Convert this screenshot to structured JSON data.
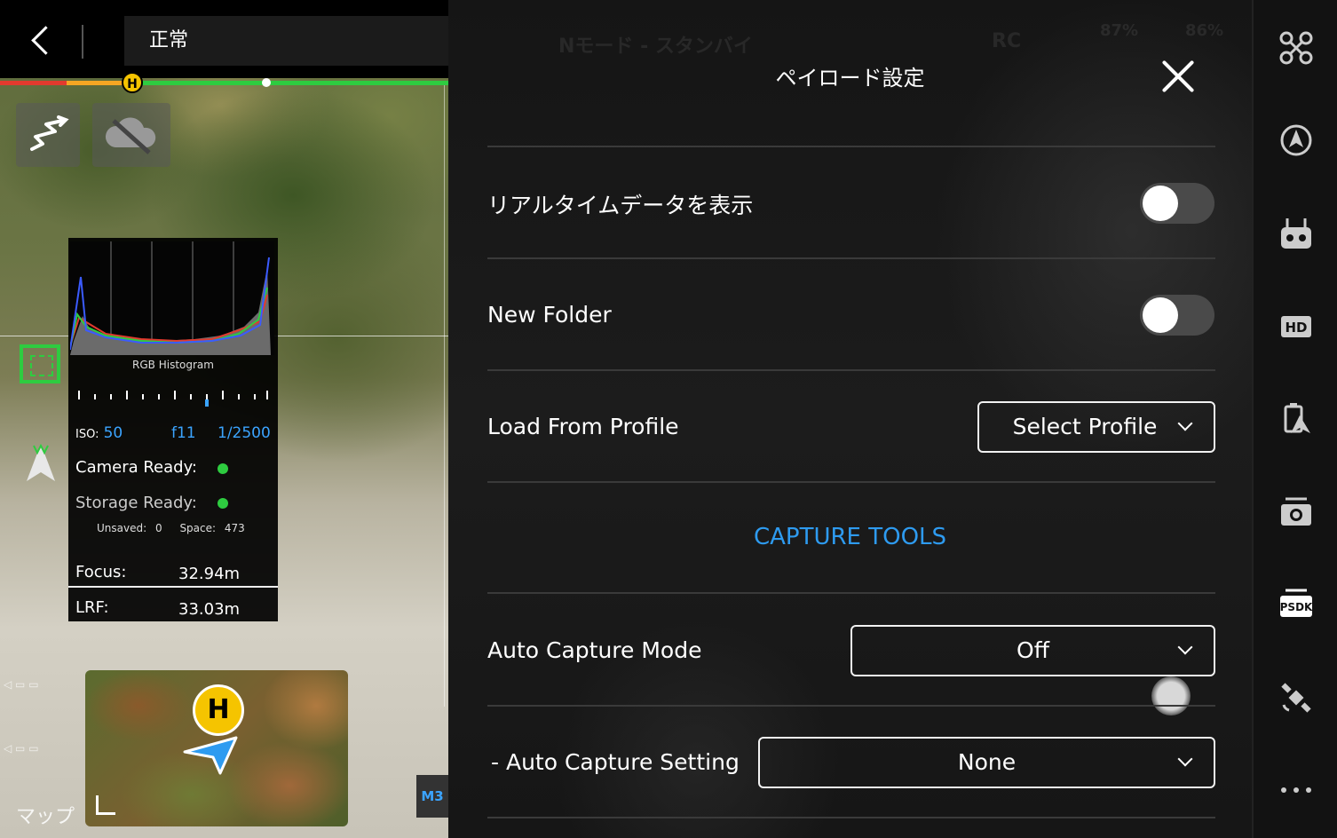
{
  "status": {
    "text": "正常"
  },
  "progress": {
    "home_marker": "H"
  },
  "histogram": {
    "label": "RGB Histogram",
    "iso_label": "ISO:",
    "iso_value": "50",
    "aperture": "f11",
    "shutter": "1/2500",
    "camera_ready": "Camera Ready:",
    "storage_ready": "Storage Ready:",
    "unsaved_label": "Unsaved:",
    "unsaved_value": "0",
    "space_label": "Space:",
    "space_value": "473",
    "focus_label": "Focus:",
    "focus_value": "32.94m",
    "lrf_label": "LRF:",
    "lrf_value": "33.03m"
  },
  "map": {
    "label": "マップ",
    "home_marker": "H",
    "model_tag": "M3"
  },
  "panel": {
    "title": "ペイロード設定",
    "ghost_mode": "Nモード - スタンバイ",
    "ghost_rc": "RC",
    "ghost_batt1": "87%",
    "ghost_batt2": "86%",
    "rows": {
      "realtime": {
        "label": "リアルタイムデータを表示",
        "on": false
      },
      "new_folder": {
        "label": "New Folder",
        "on": false
      },
      "load_profile": {
        "label": "Load From Profile",
        "value": "Select Profile"
      },
      "capture_heading": "CAPTURE TOOLS",
      "auto_capture_mode": {
        "label": "Auto Capture Mode",
        "value": "Off"
      },
      "auto_capture_setting": {
        "label": "- Auto Capture Setting",
        "value": "None"
      }
    }
  },
  "toolbar": {
    "items": [
      "aircraft-icon",
      "obstacle-avoidance-icon",
      "remote-controller-icon",
      "hd-icon",
      "rtk-icon",
      "camera-icon",
      "psdk-icon",
      "satellite-icon",
      "more-icon"
    ],
    "hd_label": "HD",
    "psdk_label": "PSDK"
  },
  "colors": {
    "accent": "#2e9bf0",
    "ok": "#2ecc40",
    "home": "#f5c400"
  }
}
